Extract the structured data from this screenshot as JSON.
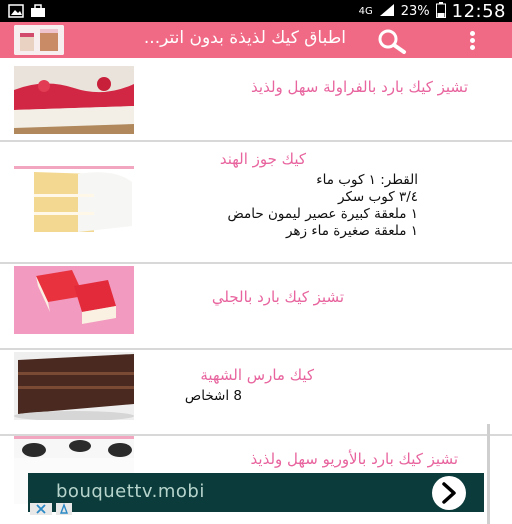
{
  "status_bar": {
    "network": "4G",
    "battery_percent": "23%",
    "time": "12:58"
  },
  "action_bar": {
    "title": "اطباق كيك لذيذة بدون انتر..."
  },
  "recipes": [
    {
      "title": "تشيز كيك بارد بالفراولة سهل ولذيذ",
      "details": []
    },
    {
      "title": "كيك جوز الهند",
      "details": [
        "القطر: ١ كوب ماء",
        "٣/٤ كوب سكر",
        "١ ملعقة كبيرة عصير ليمون حامض",
        "١ ملعقة صغيرة ماء زهر"
      ]
    },
    {
      "title": "تشيز كيك بارد بالجلي",
      "details": []
    },
    {
      "title": "كيك مارس الشهية",
      "details": [
        "8 اشخاص"
      ]
    },
    {
      "title": "تشيز كيك بارد بالأوريو سهل ولذيذ",
      "details": []
    }
  ],
  "ad": {
    "text": "bouquettv.mobi",
    "background": "#0b3b3a"
  },
  "colors": {
    "accent": "#f06a86",
    "title_pink": "#e8649e"
  }
}
